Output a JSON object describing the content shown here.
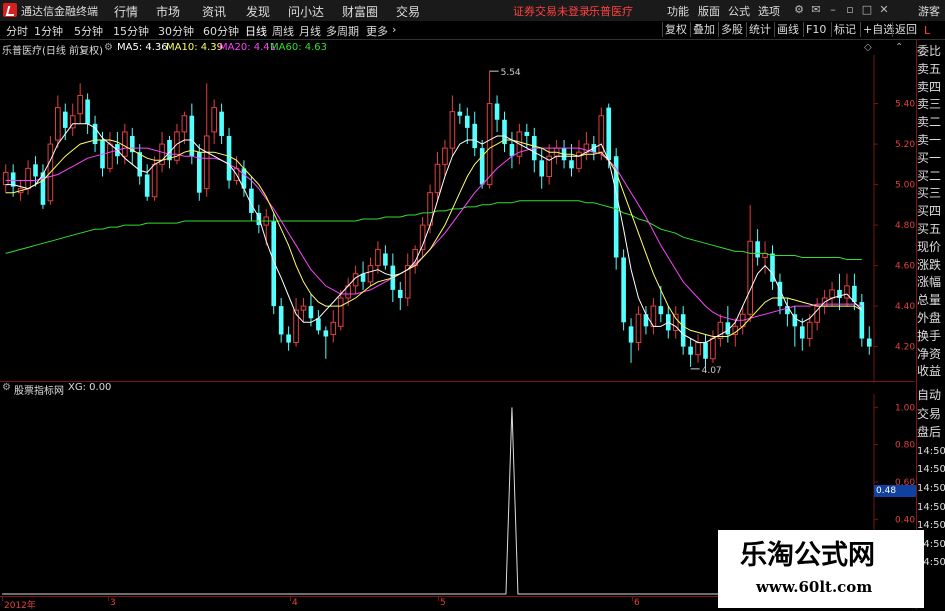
{
  "app": {
    "title": "通达信金融终端",
    "menu": [
      "行情",
      "市场",
      "资讯",
      "发现",
      "问小达",
      "财富圈",
      "交易"
    ],
    "notice_a": "证券交易未登录",
    "notice_b": "乐普医疗",
    "right_menu": [
      "功能",
      "版面",
      "公式",
      "选项"
    ],
    "login": "游客"
  },
  "toolbar": {
    "periods": [
      "分时",
      "1分钟",
      "5分钟",
      "15分钟",
      "30分钟",
      "60分钟",
      "日线",
      "周线",
      "月线",
      "多周期",
      "更多"
    ],
    "active_period": "日线",
    "tools": [
      "复权",
      "叠加",
      "多股",
      "统计",
      "画线",
      "F10",
      "标记",
      "+自选",
      "返回"
    ]
  },
  "main_chart": {
    "title": "乐普医疗(日线 前复权)",
    "ma_items": [
      {
        "label": "MA5: 4.36",
        "color": "#ffffff"
      },
      {
        "label": "MA10: 4.39",
        "color": "#ffff66"
      },
      {
        "label": "MA20: 4.41",
        "color": "#ff44ff"
      },
      {
        "label": "MA60: 4.63",
        "color": "#33dd33"
      }
    ],
    "high_marker": "5.54",
    "low_marker": "4.07",
    "y_ticks": [
      "5.40",
      "5.20",
      "5.00",
      "4.80",
      "4.60",
      "4.40",
      "4.20"
    ],
    "x_labels": [
      "2012年",
      "3",
      "4",
      "5",
      "6"
    ]
  },
  "indicator": {
    "title": "股票指标网",
    "value": "XG: 0.00",
    "y_ticks": [
      "1.00",
      "0.80",
      "0.60",
      "0.40"
    ],
    "cursor_value": "0.48"
  },
  "side_panel": [
    "委比",
    "卖五",
    "卖四",
    "卖三",
    "卖二",
    "卖一",
    "买一",
    "买二",
    "买三",
    "买四",
    "买五",
    "现价",
    "涨跌",
    "涨幅",
    "总量",
    "外盘",
    "换手",
    "净资",
    "收益",
    "自动",
    "交易",
    "盘后",
    "14:50",
    "14:50",
    "14:50",
    "14:50",
    "14:50",
    "14:50",
    "14:50"
  ],
  "corner_label": "L",
  "watermark": {
    "line1": "乐淘公式网",
    "line2": "www.60lt.com"
  },
  "colors": {
    "up": "#e04040",
    "down": "#54ffff",
    "ma5": "#ffffff",
    "ma10": "#ffff66",
    "ma20": "#ff44ff",
    "ma60": "#33dd33",
    "grid": "#7a1414"
  },
  "chart_data": [
    {
      "type": "candlestick",
      "title": "乐普医疗(日线 前复权)",
      "y_range": [
        4.05,
        5.62
      ],
      "months": [
        "2012年",
        "3",
        "4",
        "5",
        "6"
      ],
      "candles": [
        [
          5.0,
          5.06,
          5.1,
          4.96
        ],
        [
          5.06,
          4.99,
          5.1,
          4.94
        ],
        [
          4.96,
          4.98,
          5.02,
          4.92
        ],
        [
          4.98,
          5.08,
          5.12,
          4.95
        ],
        [
          5.1,
          5.04,
          5.14,
          4.99
        ],
        [
          5.06,
          4.9,
          5.1,
          4.88
        ],
        [
          4.92,
          5.2,
          5.24,
          4.9
        ],
        [
          5.22,
          5.38,
          5.44,
          5.18
        ],
        [
          5.36,
          5.28,
          5.4,
          5.22
        ],
        [
          5.28,
          5.34,
          5.4,
          5.24
        ],
        [
          5.35,
          5.44,
          5.5,
          5.3
        ],
        [
          5.42,
          5.3,
          5.45,
          5.25
        ],
        [
          5.3,
          5.2,
          5.34,
          5.16
        ],
        [
          5.22,
          5.08,
          5.26,
          5.04
        ],
        [
          5.08,
          5.2,
          5.26,
          5.06
        ],
        [
          5.2,
          5.14,
          5.26,
          5.1
        ],
        [
          5.14,
          5.26,
          5.3,
          5.1
        ],
        [
          5.24,
          5.16,
          5.28,
          5.1
        ],
        [
          5.16,
          5.04,
          5.2,
          5.0
        ],
        [
          5.05,
          4.94,
          5.1,
          4.92
        ],
        [
          4.94,
          5.1,
          5.14,
          4.92
        ],
        [
          5.1,
          5.2,
          5.26,
          5.06
        ],
        [
          5.22,
          5.12,
          5.24,
          5.08
        ],
        [
          5.12,
          5.26,
          5.3,
          5.1
        ],
        [
          5.26,
          5.34,
          5.36,
          5.2
        ],
        [
          5.34,
          5.14,
          5.4,
          5.1
        ],
        [
          5.16,
          4.96,
          5.2,
          4.92
        ],
        [
          4.98,
          5.24,
          5.5,
          4.94
        ],
        [
          5.26,
          5.38,
          5.42,
          5.2
        ],
        [
          5.36,
          5.24,
          5.4,
          5.2
        ],
        [
          5.24,
          5.02,
          5.28,
          4.98
        ],
        [
          5.02,
          5.08,
          5.14,
          5.0
        ],
        [
          5.08,
          4.98,
          5.12,
          4.94
        ],
        [
          4.98,
          4.86,
          5.04,
          4.82
        ],
        [
          4.86,
          4.8,
          4.9,
          4.76
        ],
        [
          4.8,
          4.84,
          4.88,
          4.7
        ],
        [
          4.82,
          4.4,
          4.86,
          4.36
        ],
        [
          4.4,
          4.26,
          4.44,
          4.22
        ],
        [
          4.26,
          4.22,
          4.3,
          4.18
        ],
        [
          4.22,
          4.38,
          4.44,
          4.2
        ],
        [
          4.38,
          4.4,
          4.44,
          4.32
        ],
        [
          4.4,
          4.34,
          4.46,
          4.3
        ],
        [
          4.34,
          4.28,
          4.38,
          4.26
        ],
        [
          4.28,
          4.25,
          4.3,
          4.14
        ],
        [
          4.26,
          4.32,
          4.38,
          4.22
        ],
        [
          4.3,
          4.44,
          4.48,
          4.28
        ],
        [
          4.44,
          4.5,
          4.54,
          4.4
        ],
        [
          4.5,
          4.56,
          4.6,
          4.46
        ],
        [
          4.56,
          4.52,
          4.62,
          4.48
        ],
        [
          4.52,
          4.6,
          4.64,
          4.5
        ],
        [
          4.6,
          4.68,
          4.72,
          4.56
        ],
        [
          4.66,
          4.6,
          4.7,
          4.58
        ],
        [
          4.6,
          4.48,
          4.66,
          4.42
        ],
        [
          4.48,
          4.44,
          4.52,
          4.38
        ],
        [
          4.44,
          4.6,
          4.66,
          4.4
        ],
        [
          4.6,
          4.68,
          4.7,
          4.56
        ],
        [
          4.68,
          4.8,
          4.84,
          4.64
        ],
        [
          4.8,
          4.96,
          5.0,
          4.76
        ],
        [
          4.96,
          5.1,
          5.16,
          4.92
        ],
        [
          5.1,
          5.18,
          5.22,
          5.04
        ],
        [
          5.18,
          5.36,
          5.44,
          5.14
        ],
        [
          5.36,
          5.34,
          5.4,
          5.3
        ],
        [
          5.34,
          5.28,
          5.38,
          5.2
        ],
        [
          5.3,
          5.18,
          5.36,
          5.14
        ],
        [
          5.18,
          5.0,
          5.22,
          4.98
        ],
        [
          5.0,
          5.4,
          5.56,
          4.98
        ],
        [
          5.4,
          5.32,
          5.44,
          5.26
        ],
        [
          5.32,
          5.2,
          5.36,
          5.16
        ],
        [
          5.2,
          5.14,
          5.26,
          5.08
        ],
        [
          5.14,
          5.26,
          5.3,
          5.1
        ],
        [
          5.26,
          5.24,
          5.3,
          5.18
        ],
        [
          5.24,
          5.12,
          5.28,
          5.06
        ],
        [
          5.12,
          5.04,
          5.18,
          4.98
        ],
        [
          5.04,
          5.14,
          5.2,
          5.0
        ],
        [
          5.14,
          5.18,
          5.22,
          5.1
        ],
        [
          5.18,
          5.12,
          5.22,
          5.08
        ],
        [
          5.12,
          5.08,
          5.2,
          5.04
        ],
        [
          5.08,
          5.16,
          5.22,
          5.06
        ],
        [
          5.16,
          5.2,
          5.26,
          5.12
        ],
        [
          5.2,
          5.16,
          5.24,
          5.12
        ],
        [
          5.16,
          5.34,
          5.38,
          5.12
        ],
        [
          5.38,
          5.12,
          5.4,
          5.08
        ],
        [
          5.14,
          4.64,
          5.18,
          4.58
        ],
        [
          4.64,
          4.32,
          4.68,
          4.28
        ],
        [
          4.3,
          4.22,
          4.34,
          4.12
        ],
        [
          4.22,
          4.36,
          4.4,
          4.18
        ],
        [
          4.36,
          4.3,
          4.4,
          4.26
        ],
        [
          4.3,
          4.4,
          4.44,
          4.26
        ],
        [
          4.4,
          4.36,
          4.5,
          4.32
        ],
        [
          4.36,
          4.28,
          4.4,
          4.24
        ],
        [
          4.28,
          4.36,
          4.4,
          4.24
        ],
        [
          4.36,
          4.2,
          4.4,
          4.16
        ],
        [
          4.2,
          4.16,
          4.24,
          4.1
        ],
        [
          4.16,
          4.22,
          4.26,
          4.12
        ],
        [
          4.22,
          4.14,
          4.26,
          4.1
        ],
        [
          4.14,
          4.24,
          4.28,
          4.12
        ],
        [
          4.24,
          4.32,
          4.36,
          4.2
        ],
        [
          4.32,
          4.26,
          4.4,
          4.22
        ],
        [
          4.26,
          4.3,
          4.34,
          4.2
        ],
        [
          4.3,
          4.36,
          4.4,
          4.26
        ],
        [
          4.36,
          4.72,
          4.9,
          4.32
        ],
        [
          4.72,
          4.64,
          4.78,
          4.6
        ],
        [
          4.64,
          4.66,
          4.72,
          4.56
        ],
        [
          4.66,
          4.52,
          4.7,
          4.48
        ],
        [
          4.52,
          4.4,
          4.56,
          4.36
        ],
        [
          4.4,
          4.36,
          4.44,
          4.3
        ],
        [
          4.36,
          4.3,
          4.4,
          4.2
        ],
        [
          4.3,
          4.24,
          4.34,
          4.18
        ],
        [
          4.24,
          4.32,
          4.36,
          4.2
        ],
        [
          4.32,
          4.4,
          4.44,
          4.28
        ],
        [
          4.4,
          4.44,
          4.48,
          4.36
        ],
        [
          4.44,
          4.48,
          4.52,
          4.4
        ],
        [
          4.48,
          4.44,
          4.56,
          4.38
        ],
        [
          4.44,
          4.5,
          4.56,
          4.4
        ],
        [
          4.5,
          4.42,
          4.56,
          4.38
        ],
        [
          4.42,
          4.24,
          4.46,
          4.2
        ],
        [
          4.24,
          4.2,
          4.3,
          4.16
        ]
      ],
      "ma": {
        "MA5": [
          5.0,
          5.0,
          4.99,
          4.98,
          5.0,
          5.05,
          5.12,
          5.2,
          5.25,
          5.3,
          5.3,
          5.3,
          5.28,
          5.23,
          5.2,
          5.17,
          5.13,
          5.1,
          5.07,
          5.06,
          5.1,
          5.12,
          5.16,
          5.2,
          5.22,
          5.22,
          5.18,
          5.16,
          5.14,
          5.12,
          5.1,
          5.05,
          4.98,
          4.9,
          4.84,
          4.72,
          4.62,
          4.54,
          4.45,
          4.36,
          4.32,
          4.32,
          4.34,
          4.38,
          4.42,
          4.46,
          4.5,
          4.54,
          4.56,
          4.57,
          4.58,
          4.56,
          4.55,
          4.56,
          4.58,
          4.62,
          4.7,
          4.8,
          4.92,
          5.04,
          5.14,
          5.2,
          5.22,
          5.22,
          5.2,
          5.22,
          5.24,
          5.24,
          5.22,
          5.2,
          5.18,
          5.16,
          5.14,
          5.12,
          5.14,
          5.14,
          5.14,
          5.14,
          5.16,
          5.18,
          5.2,
          5.12,
          4.96,
          4.78,
          4.58,
          4.44,
          4.36,
          4.3,
          4.3,
          4.32,
          4.3,
          4.26,
          4.24,
          4.22,
          4.22,
          4.24,
          4.26,
          4.28,
          4.32,
          4.4,
          4.48,
          4.56,
          4.6,
          4.56,
          4.48,
          4.4,
          4.34,
          4.32,
          4.34,
          4.38,
          4.42,
          4.44,
          4.45,
          4.46,
          4.42,
          4.38
        ],
        "MA10": [
          4.96,
          4.96,
          4.97,
          4.98,
          5.0,
          5.02,
          5.06,
          5.1,
          5.14,
          5.17,
          5.2,
          5.21,
          5.22,
          5.22,
          5.22,
          5.21,
          5.19,
          5.17,
          5.15,
          5.13,
          5.12,
          5.12,
          5.13,
          5.14,
          5.16,
          5.17,
          5.16,
          5.16,
          5.16,
          5.15,
          5.14,
          5.12,
          5.08,
          5.04,
          5.0,
          4.94,
          4.86,
          4.78,
          4.7,
          4.6,
          4.52,
          4.46,
          4.42,
          4.4,
          4.4,
          4.4,
          4.42,
          4.44,
          4.47,
          4.5,
          4.52,
          4.53,
          4.54,
          4.56,
          4.58,
          4.6,
          4.64,
          4.68,
          4.74,
          4.8,
          4.88,
          4.96,
          5.04,
          5.1,
          5.14,
          5.18,
          5.2,
          5.22,
          5.22,
          5.21,
          5.2,
          5.19,
          5.18,
          5.16,
          5.16,
          5.15,
          5.15,
          5.14,
          5.15,
          5.15,
          5.16,
          5.12,
          5.06,
          4.96,
          4.86,
          4.76,
          4.66,
          4.56,
          4.48,
          4.4,
          4.34,
          4.3,
          4.28,
          4.27,
          4.26,
          4.25,
          4.25,
          4.25,
          4.27,
          4.3,
          4.34,
          4.38,
          4.42,
          4.44,
          4.44,
          4.44,
          4.43,
          4.42,
          4.41,
          4.4,
          4.4,
          4.4,
          4.4,
          4.4,
          4.4,
          4.38
        ],
        "MA20": [
          5.02,
          5.02,
          5.02,
          5.02,
          5.02,
          5.03,
          5.04,
          5.05,
          5.07,
          5.09,
          5.11,
          5.13,
          5.14,
          5.15,
          5.16,
          5.17,
          5.18,
          5.18,
          5.18,
          5.18,
          5.17,
          5.16,
          5.15,
          5.15,
          5.14,
          5.14,
          5.13,
          5.13,
          5.13,
          5.12,
          5.1,
          5.08,
          5.05,
          5.02,
          4.98,
          4.93,
          4.88,
          4.82,
          4.76,
          4.7,
          4.64,
          4.58,
          4.54,
          4.5,
          4.48,
          4.46,
          4.46,
          4.46,
          4.47,
          4.48,
          4.5,
          4.52,
          4.54,
          4.56,
          4.58,
          4.61,
          4.64,
          4.68,
          4.72,
          4.76,
          4.81,
          4.86,
          4.91,
          4.96,
          5.0,
          5.04,
          5.08,
          5.11,
          5.14,
          5.16,
          5.17,
          5.18,
          5.18,
          5.18,
          5.18,
          5.18,
          5.18,
          5.18,
          5.17,
          5.16,
          5.15,
          5.12,
          5.08,
          5.02,
          4.96,
          4.9,
          4.84,
          4.77,
          4.7,
          4.64,
          4.58,
          4.52,
          4.48,
          4.44,
          4.4,
          4.37,
          4.35,
          4.34,
          4.33,
          4.33,
          4.34,
          4.35,
          4.36,
          4.37,
          4.38,
          4.39,
          4.4,
          4.4,
          4.4,
          4.41,
          4.41,
          4.41,
          4.41,
          4.41,
          4.41,
          4.4
        ],
        "MA60": [
          4.66,
          4.67,
          4.68,
          4.69,
          4.7,
          4.71,
          4.72,
          4.73,
          4.74,
          4.75,
          4.76,
          4.77,
          4.78,
          4.78,
          4.79,
          4.79,
          4.8,
          4.8,
          4.8,
          4.81,
          4.81,
          4.81,
          4.81,
          4.81,
          4.82,
          4.82,
          4.82,
          4.82,
          4.82,
          4.82,
          4.82,
          4.82,
          4.82,
          4.82,
          4.82,
          4.82,
          4.82,
          4.82,
          4.82,
          4.82,
          4.82,
          4.82,
          4.82,
          4.82,
          4.82,
          4.82,
          4.82,
          4.82,
          4.83,
          4.83,
          4.83,
          4.84,
          4.84,
          4.84,
          4.85,
          4.85,
          4.86,
          4.86,
          4.87,
          4.87,
          4.88,
          4.88,
          4.89,
          4.89,
          4.9,
          4.9,
          4.91,
          4.91,
          4.91,
          4.92,
          4.92,
          4.92,
          4.92,
          4.92,
          4.92,
          4.92,
          4.92,
          4.92,
          4.91,
          4.91,
          4.9,
          4.89,
          4.88,
          4.86,
          4.85,
          4.83,
          4.82,
          4.8,
          4.78,
          4.77,
          4.76,
          4.74,
          4.73,
          4.72,
          4.71,
          4.7,
          4.69,
          4.68,
          4.67,
          4.67,
          4.66,
          4.66,
          4.66,
          4.65,
          4.65,
          4.65,
          4.65,
          4.64,
          4.64,
          4.64,
          4.64,
          4.64,
          4.64,
          4.63,
          4.63,
          4.63
        ]
      }
    },
    {
      "type": "line",
      "title": "股票指标网",
      "series": [
        {
          "name": "XG",
          "values_desc": "zero except a single spike",
          "spike_index": 68,
          "spike_value": 1.0
        }
      ],
      "y_range": [
        0,
        1.05
      ]
    }
  ]
}
